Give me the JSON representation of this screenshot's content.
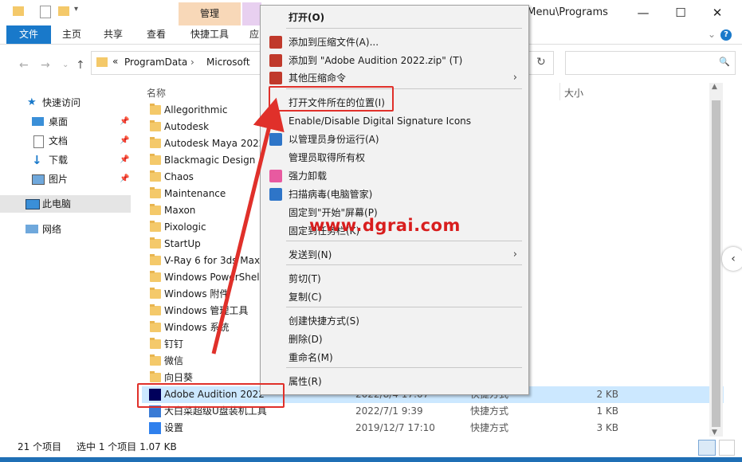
{
  "window": {
    "title_suffix": "t Menu\\Programs",
    "minimize": "—",
    "maximize": "☐",
    "close": "✕"
  },
  "ribbon": {
    "tabs": [
      "文件",
      "主页",
      "共享",
      "查看",
      "快捷工具",
      "应"
    ],
    "context_tab": "管理"
  },
  "address": {
    "crumb_sep": "«",
    "crumbs": [
      "ProgramData",
      "Microsoft"
    ],
    "refresh": "↻",
    "search_icon": "🔍"
  },
  "nav": {
    "quick_access": "快速访问",
    "items": [
      {
        "label": "桌面",
        "icon": "desktop-icon"
      },
      {
        "label": "文档",
        "icon": "documents-icon"
      },
      {
        "label": "下载",
        "icon": "download-icon"
      },
      {
        "label": "图片",
        "icon": "pictures-icon"
      }
    ],
    "this_pc": "此电脑",
    "network": "网络"
  },
  "columns": {
    "name": "名称",
    "size": "大小"
  },
  "files": [
    {
      "name": "Allegorithmic"
    },
    {
      "name": "Autodesk"
    },
    {
      "name": "Autodesk Maya 2022"
    },
    {
      "name": "Blackmagic Design"
    },
    {
      "name": "Chaos"
    },
    {
      "name": "Maintenance"
    },
    {
      "name": "Maxon"
    },
    {
      "name": "Pixologic"
    },
    {
      "name": "StartUp"
    },
    {
      "name": "V-Ray 6 for 3ds Max"
    },
    {
      "name": "Windows PowerShell"
    },
    {
      "name": "Windows 附件"
    },
    {
      "name": "Windows 管理工具"
    },
    {
      "name": "Windows 系统"
    },
    {
      "name": "钉钉"
    },
    {
      "name": "微信"
    },
    {
      "name": "向日葵"
    }
  ],
  "shortcuts": [
    {
      "name": "Adobe Audition 2022",
      "date": "2022/8/4 17:07",
      "type": "快捷方式",
      "size": "2 KB"
    },
    {
      "name": "大白菜超级U盘装机工具",
      "date": "2022/7/1 9:39",
      "type": "快捷方式",
      "size": "1 KB"
    },
    {
      "name": "设置",
      "date": "2019/12/7 17:10",
      "type": "快捷方式",
      "size": "3 KB"
    }
  ],
  "status": {
    "count": "21 个项目",
    "selected": "选中 1 个项目  1.07 KB"
  },
  "context_menu": {
    "items": [
      {
        "label": "打开(O)",
        "bold": true
      },
      {
        "label": "添加到压缩文件(A)..."
      },
      {
        "label": "添加到 \"Adobe Audition 2022.zip\" (T)"
      },
      {
        "label": "其他压缩命令"
      },
      {
        "label": "打开文件所在的位置(I)"
      },
      {
        "label": "Enable/Disable Digital Signature Icons"
      },
      {
        "label": "以管理员身份运行(A)"
      },
      {
        "label": "管理员取得所有权"
      },
      {
        "label": "强力卸载"
      },
      {
        "label": "扫描病毒(电脑管家)"
      },
      {
        "label": "固定到\"开始\"屏幕(P)"
      },
      {
        "label": "固定到任务栏(K)"
      },
      {
        "label": "发送到(N)"
      },
      {
        "label": "剪切(T)"
      },
      {
        "label": "复制(C)"
      },
      {
        "label": "创建快捷方式(S)"
      },
      {
        "label": "删除(D)"
      },
      {
        "label": "重命名(M)"
      },
      {
        "label": "属性(R)"
      }
    ]
  },
  "watermark": "www.dgrai.com",
  "colors": {
    "accent": "#1979ca",
    "highlight": "#e0302a",
    "selection": "#cce8ff"
  }
}
